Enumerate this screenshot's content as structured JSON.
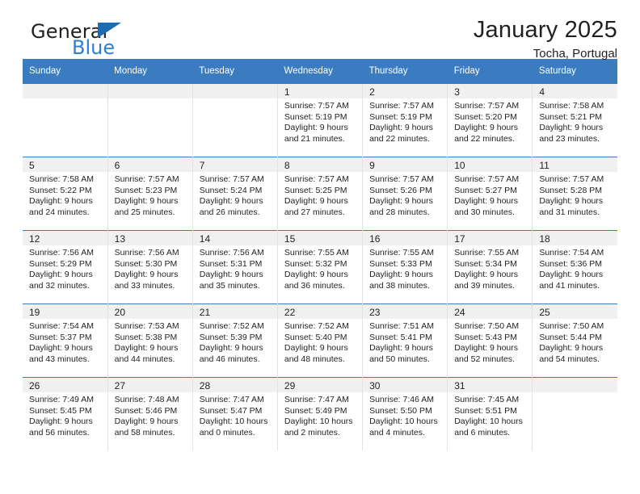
{
  "brand": {
    "name_dark": "General",
    "name_blue": "Blue",
    "triangle_icon": "blue-triangle-logo-mark",
    "accent_color": "#2980d6",
    "mark_color": "#1b6cb5"
  },
  "header": {
    "title": "January 2025",
    "subtitle": "Tocha, Portugal"
  },
  "calendar": {
    "header_bg": "#3a7cbf",
    "header_text_color": "#ffffff",
    "daynum_band_bg": "#f0f0f0",
    "weekday_headers": [
      "Sunday",
      "Monday",
      "Tuesday",
      "Wednesday",
      "Thursday",
      "Friday",
      "Saturday"
    ],
    "weeks": [
      [
        {
          "day": "",
          "empty": true,
          "sunrise": "",
          "sunset": "",
          "daylight_line1": "",
          "daylight_line2": ""
        },
        {
          "day": "",
          "empty": true,
          "sunrise": "",
          "sunset": "",
          "daylight_line1": "",
          "daylight_line2": ""
        },
        {
          "day": "",
          "empty": true,
          "sunrise": "",
          "sunset": "",
          "daylight_line1": "",
          "daylight_line2": ""
        },
        {
          "day": "1",
          "empty": false,
          "sunrise": "Sunrise: 7:57 AM",
          "sunset": "Sunset: 5:19 PM",
          "daylight_line1": "Daylight: 9 hours",
          "daylight_line2": "and 21 minutes."
        },
        {
          "day": "2",
          "empty": false,
          "sunrise": "Sunrise: 7:57 AM",
          "sunset": "Sunset: 5:19 PM",
          "daylight_line1": "Daylight: 9 hours",
          "daylight_line2": "and 22 minutes."
        },
        {
          "day": "3",
          "empty": false,
          "sunrise": "Sunrise: 7:57 AM",
          "sunset": "Sunset: 5:20 PM",
          "daylight_line1": "Daylight: 9 hours",
          "daylight_line2": "and 22 minutes."
        },
        {
          "day": "4",
          "empty": false,
          "sunrise": "Sunrise: 7:58 AM",
          "sunset": "Sunset: 5:21 PM",
          "daylight_line1": "Daylight: 9 hours",
          "daylight_line2": "and 23 minutes."
        }
      ],
      [
        {
          "day": "5",
          "empty": false,
          "sunrise": "Sunrise: 7:58 AM",
          "sunset": "Sunset: 5:22 PM",
          "daylight_line1": "Daylight: 9 hours",
          "daylight_line2": "and 24 minutes."
        },
        {
          "day": "6",
          "empty": false,
          "sunrise": "Sunrise: 7:57 AM",
          "sunset": "Sunset: 5:23 PM",
          "daylight_line1": "Daylight: 9 hours",
          "daylight_line2": "and 25 minutes."
        },
        {
          "day": "7",
          "empty": false,
          "sunrise": "Sunrise: 7:57 AM",
          "sunset": "Sunset: 5:24 PM",
          "daylight_line1": "Daylight: 9 hours",
          "daylight_line2": "and 26 minutes."
        },
        {
          "day": "8",
          "empty": false,
          "sunrise": "Sunrise: 7:57 AM",
          "sunset": "Sunset: 5:25 PM",
          "daylight_line1": "Daylight: 9 hours",
          "daylight_line2": "and 27 minutes."
        },
        {
          "day": "9",
          "empty": false,
          "sunrise": "Sunrise: 7:57 AM",
          "sunset": "Sunset: 5:26 PM",
          "daylight_line1": "Daylight: 9 hours",
          "daylight_line2": "and 28 minutes."
        },
        {
          "day": "10",
          "empty": false,
          "sunrise": "Sunrise: 7:57 AM",
          "sunset": "Sunset: 5:27 PM",
          "daylight_line1": "Daylight: 9 hours",
          "daylight_line2": "and 30 minutes."
        },
        {
          "day": "11",
          "empty": false,
          "sunrise": "Sunrise: 7:57 AM",
          "sunset": "Sunset: 5:28 PM",
          "daylight_line1": "Daylight: 9 hours",
          "daylight_line2": "and 31 minutes."
        }
      ],
      [
        {
          "day": "12",
          "empty": false,
          "sunrise": "Sunrise: 7:56 AM",
          "sunset": "Sunset: 5:29 PM",
          "daylight_line1": "Daylight: 9 hours",
          "daylight_line2": "and 32 minutes."
        },
        {
          "day": "13",
          "empty": false,
          "sunrise": "Sunrise: 7:56 AM",
          "sunset": "Sunset: 5:30 PM",
          "daylight_line1": "Daylight: 9 hours",
          "daylight_line2": "and 33 minutes."
        },
        {
          "day": "14",
          "empty": false,
          "sunrise": "Sunrise: 7:56 AM",
          "sunset": "Sunset: 5:31 PM",
          "daylight_line1": "Daylight: 9 hours",
          "daylight_line2": "and 35 minutes."
        },
        {
          "day": "15",
          "empty": false,
          "sunrise": "Sunrise: 7:55 AM",
          "sunset": "Sunset: 5:32 PM",
          "daylight_line1": "Daylight: 9 hours",
          "daylight_line2": "and 36 minutes."
        },
        {
          "day": "16",
          "empty": false,
          "sunrise": "Sunrise: 7:55 AM",
          "sunset": "Sunset: 5:33 PM",
          "daylight_line1": "Daylight: 9 hours",
          "daylight_line2": "and 38 minutes."
        },
        {
          "day": "17",
          "empty": false,
          "sunrise": "Sunrise: 7:55 AM",
          "sunset": "Sunset: 5:34 PM",
          "daylight_line1": "Daylight: 9 hours",
          "daylight_line2": "and 39 minutes."
        },
        {
          "day": "18",
          "empty": false,
          "sunrise": "Sunrise: 7:54 AM",
          "sunset": "Sunset: 5:36 PM",
          "daylight_line1": "Daylight: 9 hours",
          "daylight_line2": "and 41 minutes."
        }
      ],
      [
        {
          "day": "19",
          "empty": false,
          "sunrise": "Sunrise: 7:54 AM",
          "sunset": "Sunset: 5:37 PM",
          "daylight_line1": "Daylight: 9 hours",
          "daylight_line2": "and 43 minutes."
        },
        {
          "day": "20",
          "empty": false,
          "sunrise": "Sunrise: 7:53 AM",
          "sunset": "Sunset: 5:38 PM",
          "daylight_line1": "Daylight: 9 hours",
          "daylight_line2": "and 44 minutes."
        },
        {
          "day": "21",
          "empty": false,
          "sunrise": "Sunrise: 7:52 AM",
          "sunset": "Sunset: 5:39 PM",
          "daylight_line1": "Daylight: 9 hours",
          "daylight_line2": "and 46 minutes."
        },
        {
          "day": "22",
          "empty": false,
          "sunrise": "Sunrise: 7:52 AM",
          "sunset": "Sunset: 5:40 PM",
          "daylight_line1": "Daylight: 9 hours",
          "daylight_line2": "and 48 minutes."
        },
        {
          "day": "23",
          "empty": false,
          "sunrise": "Sunrise: 7:51 AM",
          "sunset": "Sunset: 5:41 PM",
          "daylight_line1": "Daylight: 9 hours",
          "daylight_line2": "and 50 minutes."
        },
        {
          "day": "24",
          "empty": false,
          "sunrise": "Sunrise: 7:50 AM",
          "sunset": "Sunset: 5:43 PM",
          "daylight_line1": "Daylight: 9 hours",
          "daylight_line2": "and 52 minutes."
        },
        {
          "day": "25",
          "empty": false,
          "sunrise": "Sunrise: 7:50 AM",
          "sunset": "Sunset: 5:44 PM",
          "daylight_line1": "Daylight: 9 hours",
          "daylight_line2": "and 54 minutes."
        }
      ],
      [
        {
          "day": "26",
          "empty": false,
          "sunrise": "Sunrise: 7:49 AM",
          "sunset": "Sunset: 5:45 PM",
          "daylight_line1": "Daylight: 9 hours",
          "daylight_line2": "and 56 minutes."
        },
        {
          "day": "27",
          "empty": false,
          "sunrise": "Sunrise: 7:48 AM",
          "sunset": "Sunset: 5:46 PM",
          "daylight_line1": "Daylight: 9 hours",
          "daylight_line2": "and 58 minutes."
        },
        {
          "day": "28",
          "empty": false,
          "sunrise": "Sunrise: 7:47 AM",
          "sunset": "Sunset: 5:47 PM",
          "daylight_line1": "Daylight: 10 hours",
          "daylight_line2": "and 0 minutes."
        },
        {
          "day": "29",
          "empty": false,
          "sunrise": "Sunrise: 7:47 AM",
          "sunset": "Sunset: 5:49 PM",
          "daylight_line1": "Daylight: 10 hours",
          "daylight_line2": "and 2 minutes."
        },
        {
          "day": "30",
          "empty": false,
          "sunrise": "Sunrise: 7:46 AM",
          "sunset": "Sunset: 5:50 PM",
          "daylight_line1": "Daylight: 10 hours",
          "daylight_line2": "and 4 minutes."
        },
        {
          "day": "31",
          "empty": false,
          "sunrise": "Sunrise: 7:45 AM",
          "sunset": "Sunset: 5:51 PM",
          "daylight_line1": "Daylight: 10 hours",
          "daylight_line2": "and 6 minutes."
        },
        {
          "day": "",
          "empty": true,
          "sunrise": "",
          "sunset": "",
          "daylight_line1": "",
          "daylight_line2": ""
        }
      ]
    ]
  }
}
